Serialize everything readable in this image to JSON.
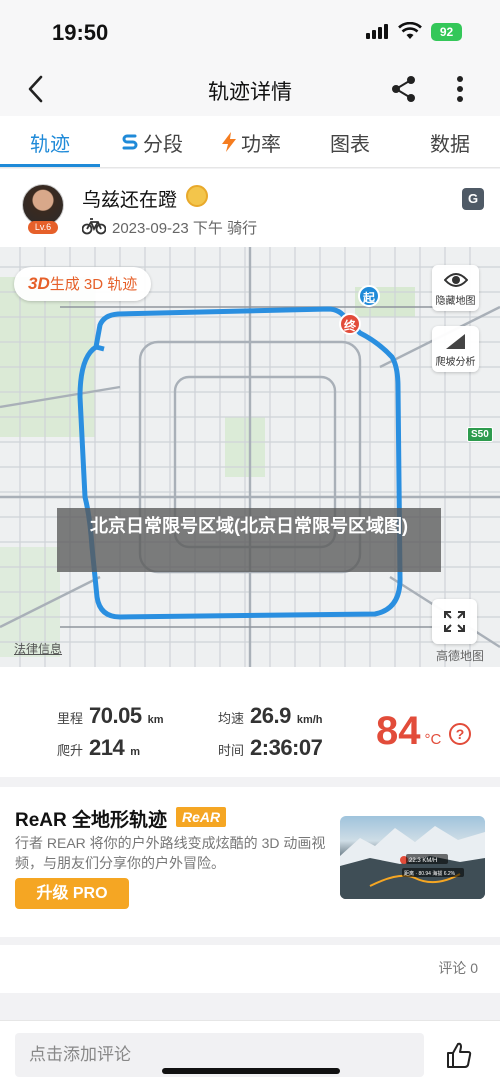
{
  "status_bar": {
    "time": "19:50",
    "battery": "92"
  },
  "nav": {
    "title": "轨迹详情"
  },
  "tabs": [
    {
      "label": "轨迹",
      "icon": ""
    },
    {
      "label": "分段",
      "icon": "segment-icon"
    },
    {
      "label": "功率",
      "icon": "lightning-icon"
    },
    {
      "label": "图表",
      "icon": ""
    },
    {
      "label": "数据",
      "icon": ""
    }
  ],
  "user": {
    "name": "乌兹还在蹬",
    "level": "Lv.6",
    "meta": "2023-09-23 下午 骑行"
  },
  "map": {
    "btn_3d_prefix": "3D",
    "btn_3d_text": "生成 3D 轨迹",
    "hide_map": "隐藏地图",
    "climb_analysis": "爬坡分析",
    "start": "起",
    "end": "终",
    "route_sign": "S50",
    "legal": "法律信息",
    "logo": "高德地图",
    "caption": "北京日常限号区域(北京日常限号区域图)"
  },
  "stats": {
    "distance": {
      "label": "里程",
      "value": "70.05",
      "unit": "km"
    },
    "avg_speed": {
      "label": "均速",
      "value": "26.9",
      "unit": "km/h"
    },
    "climb": {
      "label": "爬升",
      "value": "214",
      "unit": "m"
    },
    "time": {
      "label": "时间",
      "value": "2:36:07",
      "unit": ""
    },
    "temperature": {
      "value": "84",
      "unit": "°C"
    }
  },
  "promo": {
    "title": "ReAR 全地形轨迹",
    "badge": "ReAR",
    "desc": "行者 REAR 将你的户外路线变成炫酷的 3D 动画视频，与朋友们分享你的户外冒险。",
    "button": "升级 PRO",
    "image_line1": "22.3 KM/H",
    "image_line2": "距离 · 80.94    海拔 6.2%"
  },
  "comments": {
    "count_label": "评论 0"
  },
  "bottom": {
    "input_placeholder": "点击添加评论"
  },
  "colors": {
    "accent": "#1f8ad8",
    "route": "#2a8fe0",
    "orange": "#f5a623",
    "red": "#e24c3a"
  }
}
